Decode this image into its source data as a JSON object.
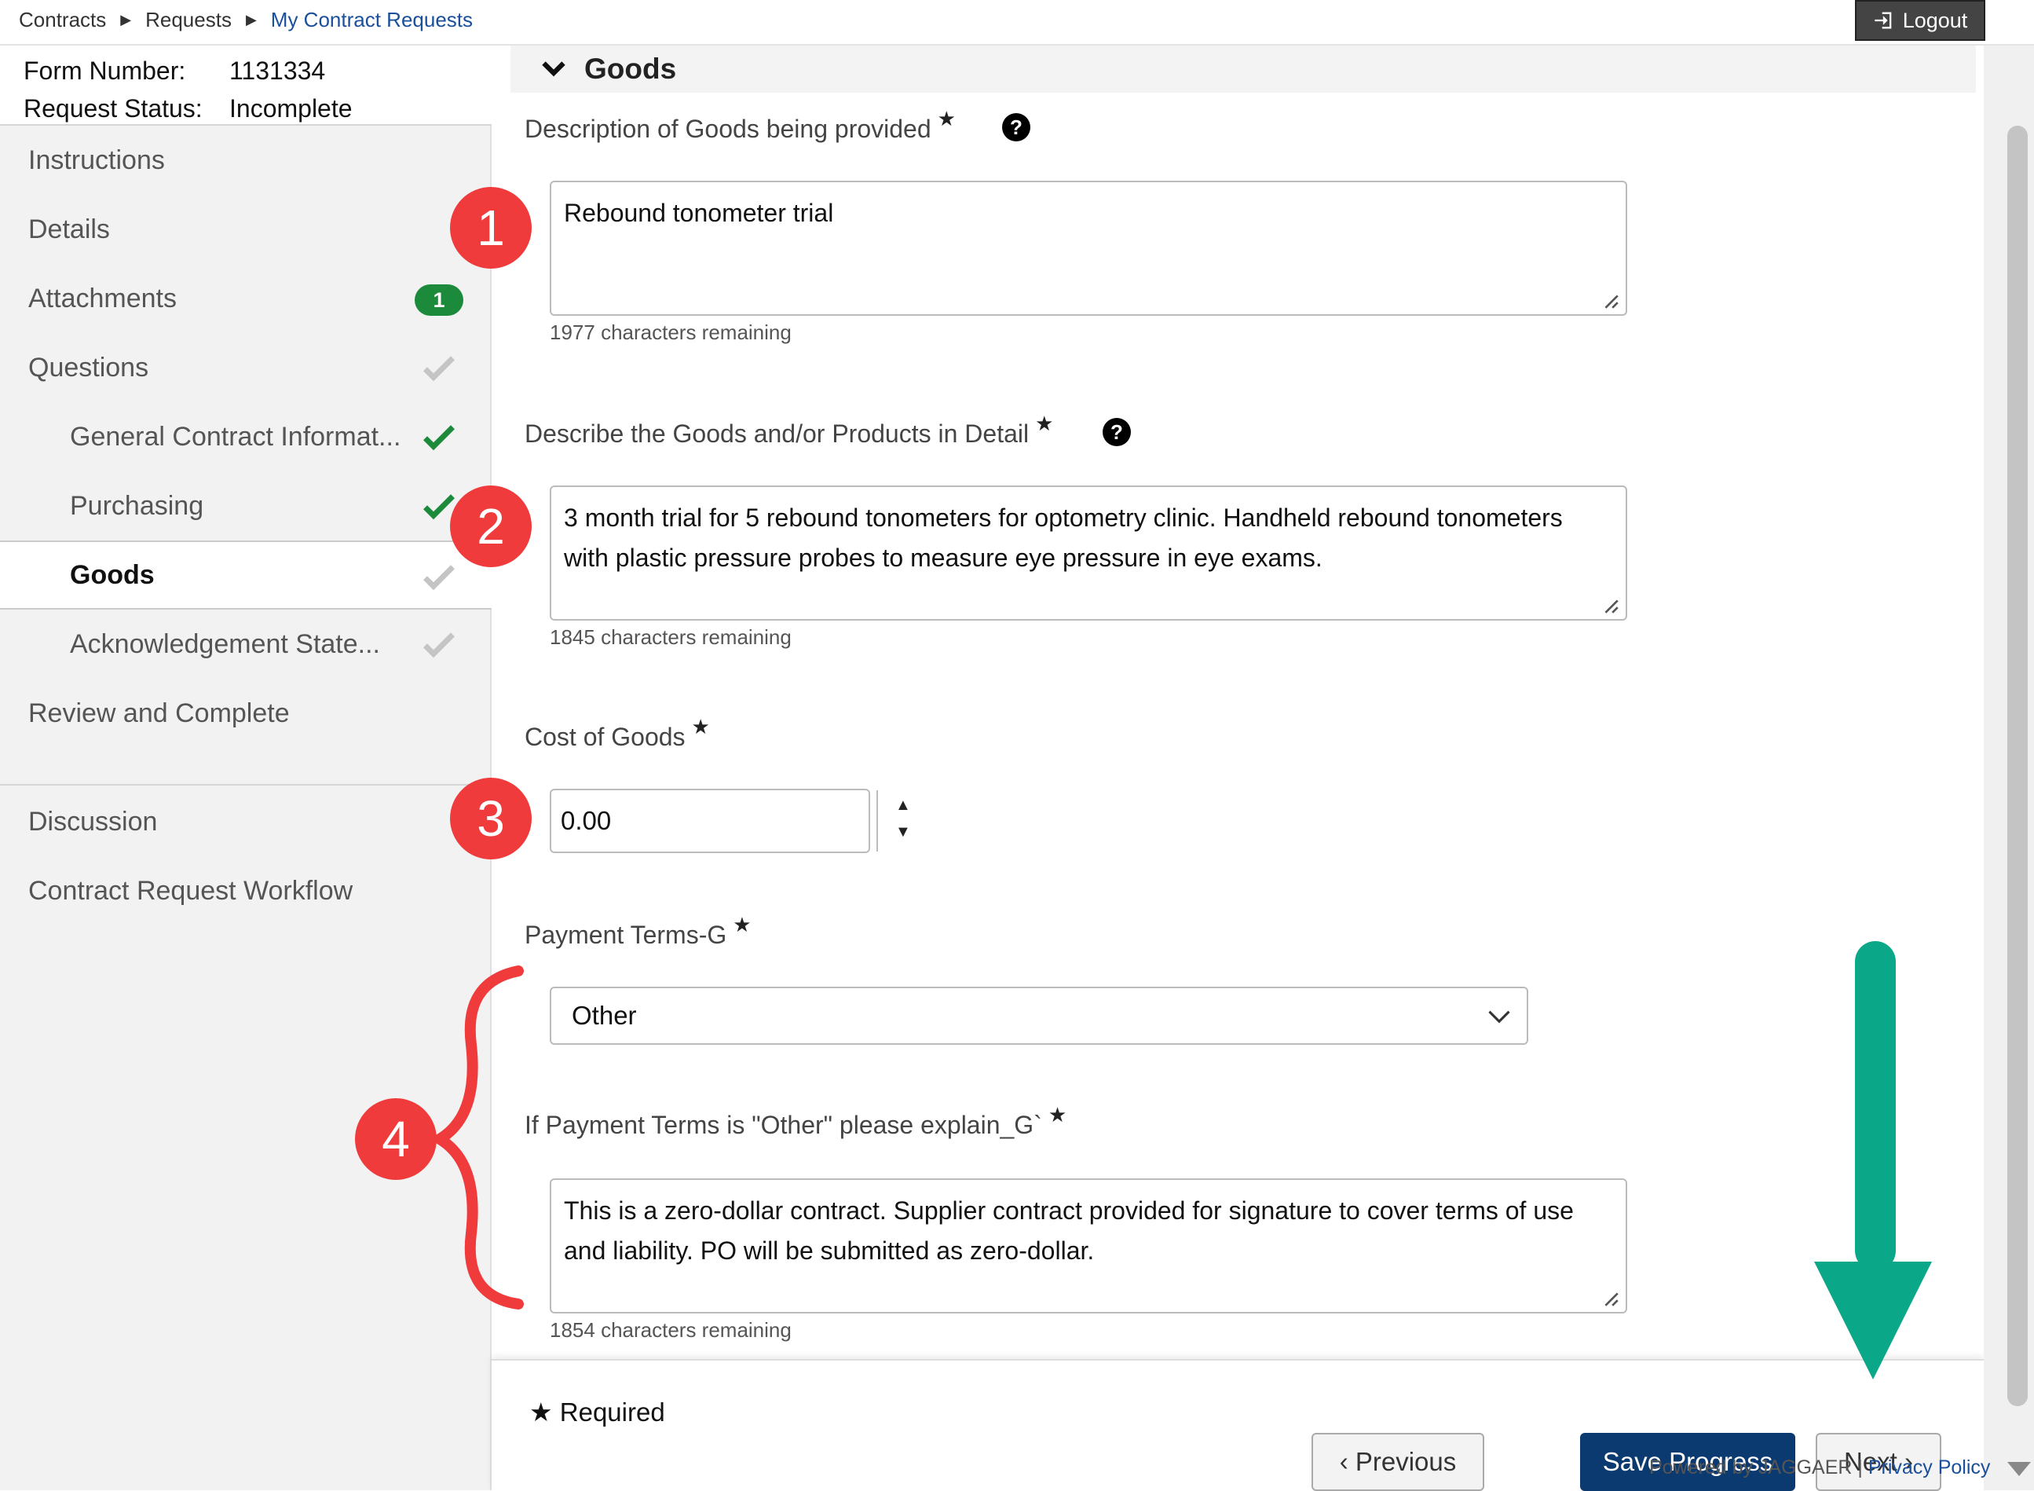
{
  "breadcrumb": {
    "items": [
      "Contracts",
      "Requests",
      "My Contract Requests"
    ]
  },
  "header": {
    "logout_label": "Logout"
  },
  "form_info": {
    "form_number_label": "Form Number:",
    "form_number": "1131334",
    "status_label": "Request Status:",
    "status": "Incomplete"
  },
  "sidebar": {
    "items": [
      {
        "label": "Instructions"
      },
      {
        "label": "Details"
      },
      {
        "label": "Attachments",
        "badge": "1"
      },
      {
        "label": "Questions",
        "status": "grey-check"
      },
      {
        "label": "General Contract Informat...",
        "status": "green-check"
      },
      {
        "label": "Purchasing",
        "status": "green-check"
      },
      {
        "label": "Goods",
        "status": "grey-check",
        "active": true
      },
      {
        "label": "Acknowledgement State...",
        "status": "grey-check"
      },
      {
        "label": "Review and Complete"
      }
    ],
    "extra_items": [
      {
        "label": "Discussion"
      },
      {
        "label": "Contract Request Workflow"
      }
    ]
  },
  "section": {
    "title": "Goods"
  },
  "fields": {
    "description": {
      "label": "Description of Goods being provided",
      "value": "Rebound tonometer trial",
      "remaining": "1977 characters remaining"
    },
    "detail": {
      "label": "Describe the Goods and/or Products in Detail",
      "value": "3 month trial for 5 rebound tonometers for optometry clinic. Handheld rebound tonometers with plastic pressure probes to measure eye pressure in eye exams.",
      "remaining": "1845 characters remaining"
    },
    "cost": {
      "label": "Cost of Goods",
      "value": "0.00"
    },
    "payment_terms": {
      "label": "Payment Terms-G",
      "value": "Other"
    },
    "other_explain": {
      "label": "If Payment Terms is \"Other\" please explain_G`",
      "value": "This is a zero-dollar contract. Supplier contract provided for signature to cover terms of use and liability. PO will be submitted as zero-dollar.",
      "remaining": "1854 characters remaining"
    },
    "required_mark": "★",
    "help_mark": "?"
  },
  "footer": {
    "required_note": "Required",
    "previous_label": "‹ Previous",
    "save_label": "Save Progress",
    "next_label": "Next ›"
  },
  "powered_by": {
    "text": "Powered by JAGGAER |",
    "link": "Privacy Policy"
  },
  "annotations": {
    "markers": [
      "1",
      "2",
      "3",
      "4"
    ]
  },
  "colors": {
    "accent": "#0b3a70",
    "link": "#1a4f9c",
    "badge": "#1b8a3b",
    "annotation_red": "#ef3b3b",
    "annotation_arrow": "#0aa888"
  }
}
